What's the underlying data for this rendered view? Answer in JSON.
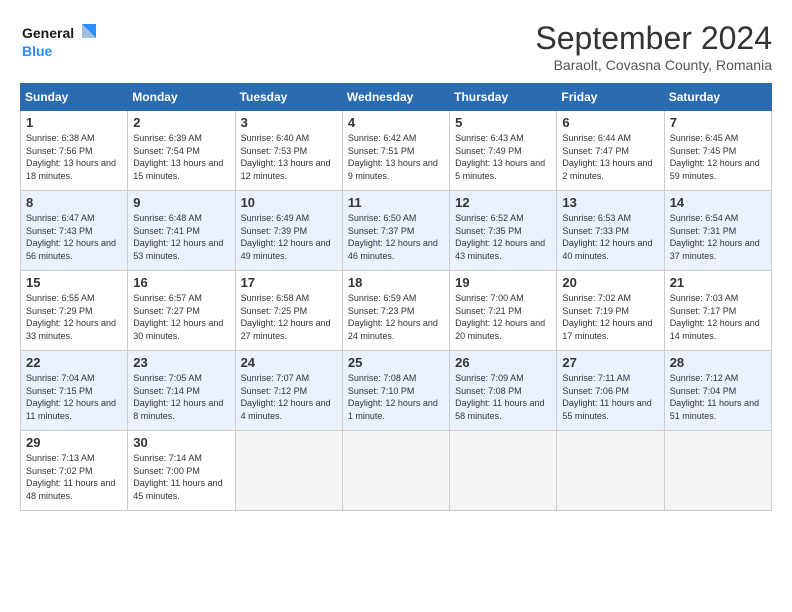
{
  "header": {
    "logo_line1": "General",
    "logo_line2": "Blue",
    "month": "September 2024",
    "location": "Baraolt, Covasna County, Romania"
  },
  "days_of_week": [
    "Sunday",
    "Monday",
    "Tuesday",
    "Wednesday",
    "Thursday",
    "Friday",
    "Saturday"
  ],
  "weeks": [
    [
      {
        "num": "1",
        "sunrise": "6:38 AM",
        "sunset": "7:56 PM",
        "daylight": "13 hours and 18 minutes."
      },
      {
        "num": "2",
        "sunrise": "6:39 AM",
        "sunset": "7:54 PM",
        "daylight": "13 hours and 15 minutes."
      },
      {
        "num": "3",
        "sunrise": "6:40 AM",
        "sunset": "7:53 PM",
        "daylight": "13 hours and 12 minutes."
      },
      {
        "num": "4",
        "sunrise": "6:42 AM",
        "sunset": "7:51 PM",
        "daylight": "13 hours and 9 minutes."
      },
      {
        "num": "5",
        "sunrise": "6:43 AM",
        "sunset": "7:49 PM",
        "daylight": "13 hours and 5 minutes."
      },
      {
        "num": "6",
        "sunrise": "6:44 AM",
        "sunset": "7:47 PM",
        "daylight": "13 hours and 2 minutes."
      },
      {
        "num": "7",
        "sunrise": "6:45 AM",
        "sunset": "7:45 PM",
        "daylight": "12 hours and 59 minutes."
      }
    ],
    [
      {
        "num": "8",
        "sunrise": "6:47 AM",
        "sunset": "7:43 PM",
        "daylight": "12 hours and 56 minutes."
      },
      {
        "num": "9",
        "sunrise": "6:48 AM",
        "sunset": "7:41 PM",
        "daylight": "12 hours and 53 minutes."
      },
      {
        "num": "10",
        "sunrise": "6:49 AM",
        "sunset": "7:39 PM",
        "daylight": "12 hours and 49 minutes."
      },
      {
        "num": "11",
        "sunrise": "6:50 AM",
        "sunset": "7:37 PM",
        "daylight": "12 hours and 46 minutes."
      },
      {
        "num": "12",
        "sunrise": "6:52 AM",
        "sunset": "7:35 PM",
        "daylight": "12 hours and 43 minutes."
      },
      {
        "num": "13",
        "sunrise": "6:53 AM",
        "sunset": "7:33 PM",
        "daylight": "12 hours and 40 minutes."
      },
      {
        "num": "14",
        "sunrise": "6:54 AM",
        "sunset": "7:31 PM",
        "daylight": "12 hours and 37 minutes."
      }
    ],
    [
      {
        "num": "15",
        "sunrise": "6:55 AM",
        "sunset": "7:29 PM",
        "daylight": "12 hours and 33 minutes."
      },
      {
        "num": "16",
        "sunrise": "6:57 AM",
        "sunset": "7:27 PM",
        "daylight": "12 hours and 30 minutes."
      },
      {
        "num": "17",
        "sunrise": "6:58 AM",
        "sunset": "7:25 PM",
        "daylight": "12 hours and 27 minutes."
      },
      {
        "num": "18",
        "sunrise": "6:59 AM",
        "sunset": "7:23 PM",
        "daylight": "12 hours and 24 minutes."
      },
      {
        "num": "19",
        "sunrise": "7:00 AM",
        "sunset": "7:21 PM",
        "daylight": "12 hours and 20 minutes."
      },
      {
        "num": "20",
        "sunrise": "7:02 AM",
        "sunset": "7:19 PM",
        "daylight": "12 hours and 17 minutes."
      },
      {
        "num": "21",
        "sunrise": "7:03 AM",
        "sunset": "7:17 PM",
        "daylight": "12 hours and 14 minutes."
      }
    ],
    [
      {
        "num": "22",
        "sunrise": "7:04 AM",
        "sunset": "7:15 PM",
        "daylight": "12 hours and 11 minutes."
      },
      {
        "num": "23",
        "sunrise": "7:05 AM",
        "sunset": "7:14 PM",
        "daylight": "12 hours and 8 minutes."
      },
      {
        "num": "24",
        "sunrise": "7:07 AM",
        "sunset": "7:12 PM",
        "daylight": "12 hours and 4 minutes."
      },
      {
        "num": "25",
        "sunrise": "7:08 AM",
        "sunset": "7:10 PM",
        "daylight": "12 hours and 1 minute."
      },
      {
        "num": "26",
        "sunrise": "7:09 AM",
        "sunset": "7:08 PM",
        "daylight": "11 hours and 58 minutes."
      },
      {
        "num": "27",
        "sunrise": "7:11 AM",
        "sunset": "7:06 PM",
        "daylight": "11 hours and 55 minutes."
      },
      {
        "num": "28",
        "sunrise": "7:12 AM",
        "sunset": "7:04 PM",
        "daylight": "11 hours and 51 minutes."
      }
    ],
    [
      {
        "num": "29",
        "sunrise": "7:13 AM",
        "sunset": "7:02 PM",
        "daylight": "11 hours and 48 minutes."
      },
      {
        "num": "30",
        "sunrise": "7:14 AM",
        "sunset": "7:00 PM",
        "daylight": "11 hours and 45 minutes."
      },
      null,
      null,
      null,
      null,
      null
    ]
  ]
}
